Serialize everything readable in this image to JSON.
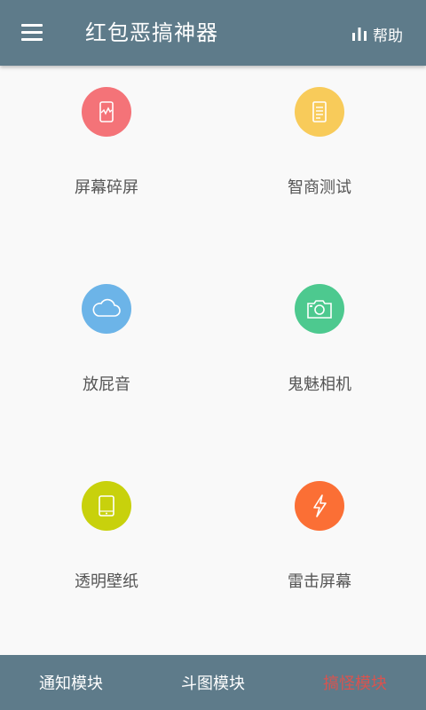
{
  "appbar": {
    "title": "红包恶搞神器",
    "help_label": "帮助",
    "help_icon": "bar-chart-icon"
  },
  "colors": {
    "appbar_bg": "#5e7b8a",
    "active_tab": "#d9534f"
  },
  "features": [
    {
      "label": "屏幕碎屏",
      "icon": "cracked-screen-icon",
      "color": "#f47378"
    },
    {
      "label": "智商测试",
      "icon": "document-icon",
      "color": "#f8cb5a"
    },
    {
      "label": "放屁音",
      "icon": "cloud-icon",
      "color": "#6cb4e8"
    },
    {
      "label": "鬼魅相机",
      "icon": "camera-icon",
      "color": "#4dc98f"
    },
    {
      "label": "透明壁纸",
      "icon": "tablet-icon",
      "color": "#c8d10c"
    },
    {
      "label": "雷击屏幕",
      "icon": "lightning-icon",
      "color": "#fb6f35"
    }
  ],
  "bottom_nav": [
    {
      "label": "通知模块",
      "active": false
    },
    {
      "label": "斗图模块",
      "active": false
    },
    {
      "label": "搞怪模块",
      "active": true
    }
  ]
}
